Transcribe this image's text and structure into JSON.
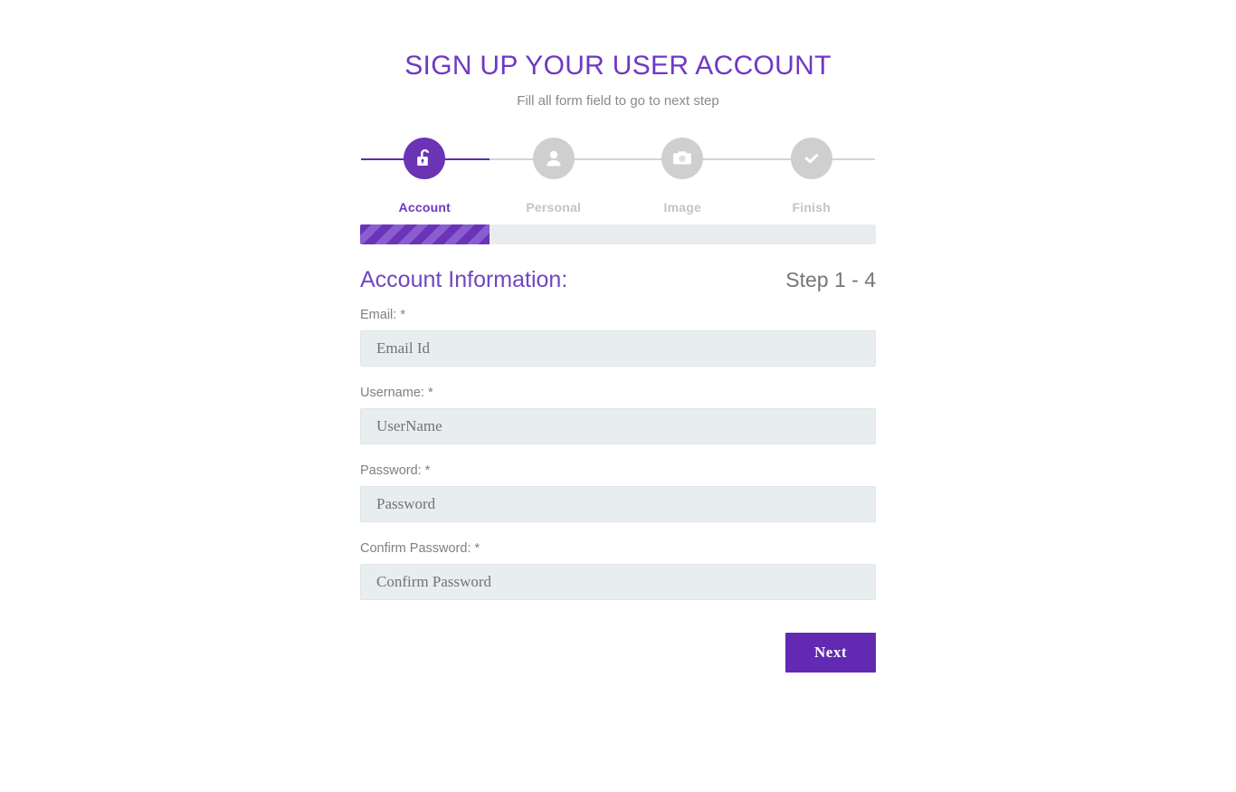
{
  "header": {
    "title": "SIGN UP YOUR USER ACCOUNT",
    "subtitle": "Fill all form field to go to next step"
  },
  "colors": {
    "accent": "#6f38c4",
    "accent_dark": "#6229b3",
    "accent_circle": "#6a34b5",
    "inactive": "#cfcfcf",
    "inactive_label": "#c4c4c4",
    "track": "#d3d3d3",
    "progress_track": "#e8ecef",
    "progress_stripe_dark": "#6b34b8",
    "progress_stripe_light": "#8a5ed0",
    "input_bg": "#e8edf0",
    "label_text": "#808080",
    "subtitle_text": "#8a8a8a"
  },
  "stepper": {
    "progress_percent": 25,
    "steps": [
      {
        "label": "Account",
        "icon": "unlock-icon",
        "active": true
      },
      {
        "label": "Personal",
        "icon": "user-icon",
        "active": false
      },
      {
        "label": "Image",
        "icon": "camera-icon",
        "active": false
      },
      {
        "label": "Finish",
        "icon": "check-icon",
        "active": false
      }
    ]
  },
  "section": {
    "title": "Account Information:",
    "step_counter": "Step 1 - 4"
  },
  "form": {
    "fields": [
      {
        "label": "Email: *",
        "placeholder": "Email Id",
        "value": "",
        "type": "text",
        "name": "email-field"
      },
      {
        "label": "Username: *",
        "placeholder": "UserName",
        "value": "",
        "type": "text",
        "name": "username-field"
      },
      {
        "label": "Password: *",
        "placeholder": "Password",
        "value": "",
        "type": "password",
        "name": "password-field"
      },
      {
        "label": "Confirm Password: *",
        "placeholder": "Confirm Password",
        "value": "",
        "type": "password",
        "name": "confirm-password-field"
      }
    ],
    "next_label": "Next"
  }
}
